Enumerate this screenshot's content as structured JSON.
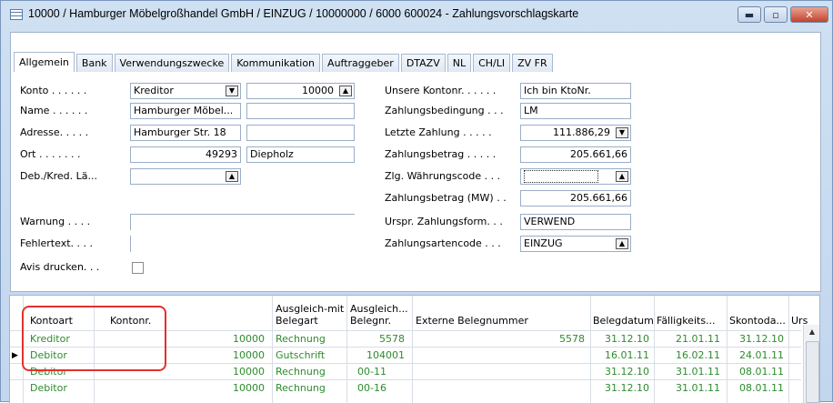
{
  "window": {
    "title": "10000 / Hamburger Möbelgroßhandel GmbH / EINZUG / 10000000 / 6000 600024 - Zahlungsvorschlagskarte",
    "minimize_glyph": "▬",
    "maximize_glyph": "▫",
    "close_glyph": "✕"
  },
  "tabs": [
    "Allgemein",
    "Bank",
    "Verwendungszwecke",
    "Kommunikation",
    "Auftraggeber",
    "DTAZV",
    "NL",
    "CH/LI",
    "ZV FR"
  ],
  "left": {
    "konto_label": "Konto . . . . . .",
    "konto_type": "Kreditor",
    "konto_no": "10000",
    "name_label": "Name . . . . . .",
    "name": "Hamburger Möbel...",
    "name2": "",
    "adresse_label": "Adresse. . . . .",
    "adresse": "Hamburger Str. 18",
    "adresse2": "",
    "ort_label": "Ort . . . . . . .",
    "plz": "49293",
    "ort": "Diepholz",
    "debkred_label": "Deb./Kred. Lä...",
    "debkred": "",
    "warnung_label": "Warnung . . . .",
    "fehler_label": "Fehlertext. . . .",
    "avis_label": "Avis drucken. . ."
  },
  "right": {
    "kontonr_label": "Unsere Kontonr. . . . . .",
    "kontonr": "Ich bin KtoNr.",
    "zbed_label": "Zahlungsbedingung . . .",
    "zbed": "LM",
    "letzte_label": "Letzte Zahlung . . . . .",
    "letzte": "111.886,29",
    "zbetrag_label": "Zahlungsbetrag . . . . .",
    "zbetrag": "205.661,66",
    "wcode_label": "Zlg. Währungscode . . .",
    "wcode": "",
    "zbetragmw_label": "Zahlungsbetrag (MW) . .",
    "zbetragmw": "205.661,66",
    "urspr_label": "Urspr. Zahlungsform. . .",
    "urspr": "VERWEND",
    "zart_label": "Zahlungsartencode . . .",
    "zart": "EINZUG"
  },
  "grid": {
    "headers": {
      "kontoart": "Kontoart",
      "kontonr": "Kontonr.",
      "ausgl_belegart_1": "Ausgleich-mit",
      "ausgl_belegart_2": "Belegart",
      "ausgl_belegnr_1": "Ausgleich...",
      "ausgl_belegnr_2": "Belegnr.",
      "extern": "Externe Belegnummer",
      "belegdatum": "Belegdatum",
      "faellig": "Fälligkeits...",
      "skonto": "Skontoda...",
      "urs": "Urs"
    },
    "rows": [
      {
        "kontoart": "Kreditor",
        "kontonr": "10000",
        "belegart": "Rechnung",
        "belegnr": "5578",
        "extern": "5578",
        "belegdatum": "31.12.10",
        "faellig": "21.01.11",
        "skonto": "31.12.10"
      },
      {
        "kontoart": "Debitor",
        "kontonr": "10000",
        "belegart": "Gutschrift",
        "belegnr": "104001",
        "extern": "",
        "belegdatum": "16.01.11",
        "faellig": "16.02.11",
        "skonto": "24.01.11"
      },
      {
        "kontoart": "Debitor",
        "kontonr": "10000",
        "belegart": "Rechnung",
        "belegnr": "00-11",
        "extern": "",
        "belegdatum": "31.12.10",
        "faellig": "31.01.11",
        "skonto": "08.01.11"
      },
      {
        "kontoart": "Debitor",
        "kontonr": "10000",
        "belegart": "Rechnung",
        "belegnr": "00-16",
        "extern": "",
        "belegdatum": "31.12.10",
        "faellig": "31.01.11",
        "skonto": "08.01.11"
      }
    ]
  },
  "icons": {
    "dropdown": "▼",
    "lookup": "▲",
    "lookup_down": "▼",
    "current_row": "▶",
    "scroll_up": "▲"
  }
}
